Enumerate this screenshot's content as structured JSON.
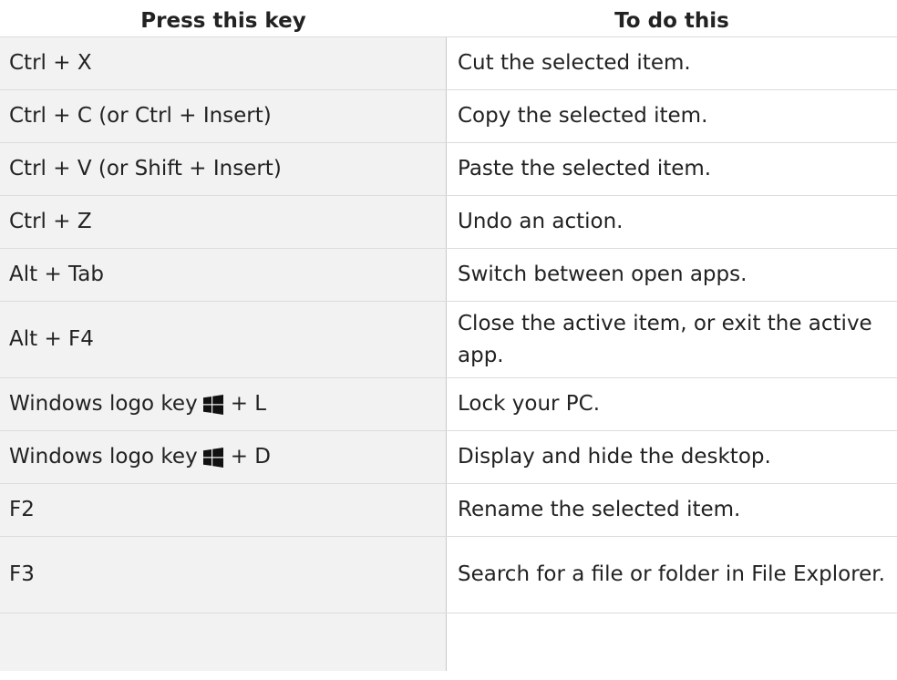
{
  "headers": {
    "key": "Press this key",
    "action": "To do this"
  },
  "rows": [
    {
      "key": "Ctrl + X",
      "action": "Cut the selected item."
    },
    {
      "key": "Ctrl + C (or Ctrl + Insert)",
      "action": "Copy the selected item."
    },
    {
      "key": "Ctrl + V (or Shift + Insert)",
      "action": "Paste the selected item."
    },
    {
      "key": "Ctrl + Z",
      "action": "Undo an action."
    },
    {
      "key": "Alt + Tab",
      "action": "Switch between open apps."
    },
    {
      "key": "Alt + F4",
      "action": "Close the active item, or exit the active app."
    },
    {
      "key_prefix": "Windows logo key",
      "key_suffix": "+ L",
      "key_icon": "windows-logo-icon",
      "action": "Lock your PC."
    },
    {
      "key_prefix": "Windows logo key",
      "key_suffix": "+ D",
      "key_icon": "windows-logo-icon",
      "action": "Display and hide the desktop."
    },
    {
      "key": "F2",
      "action": "Rename the selected item."
    },
    {
      "key": "F3",
      "action": "Search for a file or folder in File Explorer."
    },
    {
      "key": "",
      "action": ""
    }
  ]
}
